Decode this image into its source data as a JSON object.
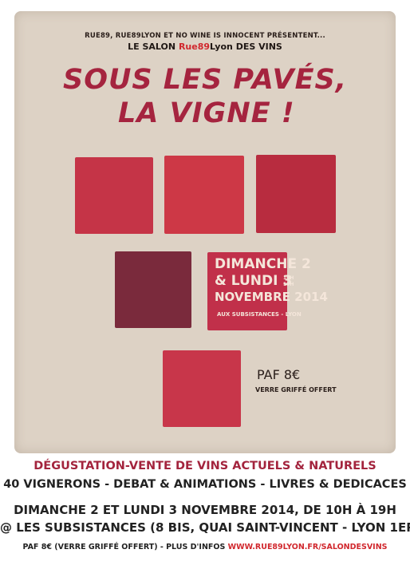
{
  "header": {
    "presenters": "RUE89, RUE89LYON ET NO WINE IS INNOCENT PRÉSENTENT...",
    "salon_prefix": "LE SALON",
    "salon_brand": "Rue89",
    "salon_brand_suffix": "Lyon",
    "salon_suffix": "DES VINS"
  },
  "title": {
    "line1": "SOUS LES PAVÉS,",
    "line2": "LA VIGNE !"
  },
  "date_box": {
    "line1": "DIMANCHE 2",
    "line2": "& LUNDI 3",
    "hours_start": "10H",
    "hours_end": "19H",
    "line3": "NOVEMBRE 2014",
    "line4": "AUX SUBSISTANCES - LYON"
  },
  "price": {
    "paf": "PAF 8€",
    "verre": "VERRE GRIFFÉ OFFERT"
  },
  "footer": {
    "line1": "DÉGUSTATION-VENTE DE VINS ACTUELS & NATURELS",
    "line2": "40 VIGNERONS - DEBAT & ANIMATIONS - LIVRES & DEDICACES",
    "line3": "DIMANCHE 2 ET LUNDI 3 NOVEMBRE 2014, DE 10H À 19H",
    "line4": "@ LES SUBSISTANCES (8 BIS, QUAI SAINT-VINCENT - LYON 1ER)",
    "line5_text": "PAF 8€ (VERRE GRIFFÉ OFFERT) - PLUS D'INFOS",
    "line5_url": "WWW.RUE89LYON.FR/SALONDESVINS"
  },
  "colors": {
    "accent": "#a5243f",
    "brand_red": "#d1282e",
    "paper": "#ddd2c5"
  }
}
